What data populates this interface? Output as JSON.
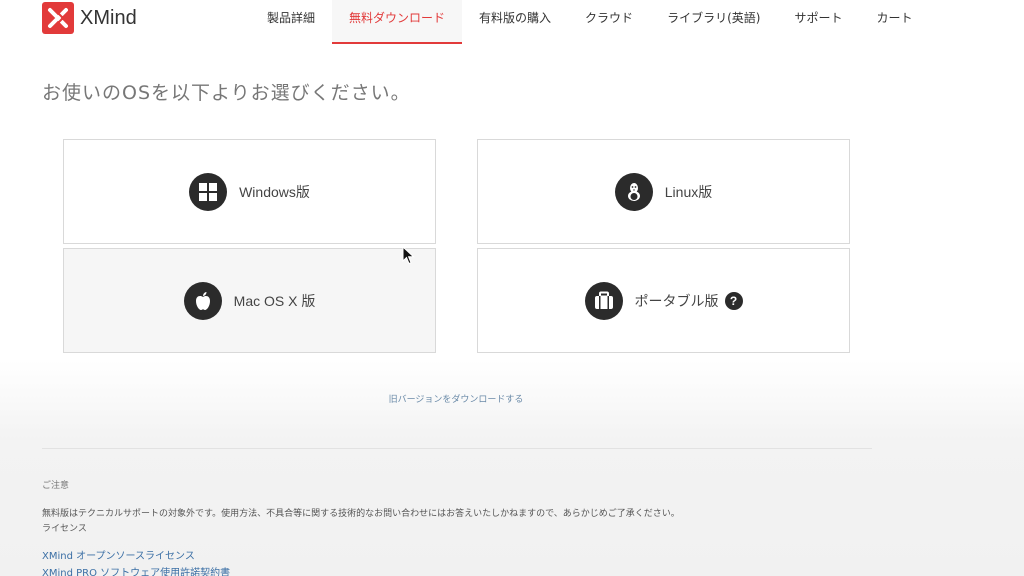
{
  "header": {
    "logo_text": "XMind",
    "nav": [
      {
        "label": "製品詳細"
      },
      {
        "label": "無料ダウンロード",
        "active": true
      },
      {
        "label": "有料版の購入"
      },
      {
        "label": "クラウド"
      },
      {
        "label": "ライブラリ(英語)"
      },
      {
        "label": "サポート"
      },
      {
        "label": "カート"
      }
    ]
  },
  "main": {
    "prompt": "お使いのOSを以下よりお選びください。",
    "options": [
      {
        "label": "Windows版",
        "icon": "windows-icon"
      },
      {
        "label": "Linux版",
        "icon": "linux-icon"
      },
      {
        "label": "Mac OS X 版",
        "icon": "apple-icon"
      },
      {
        "label": "ポータブル版",
        "icon": "briefcase-icon",
        "help": "?"
      }
    ],
    "old_version_link": "旧バージョンをダウンロードする"
  },
  "footer": {
    "note_title": "ご注意",
    "note_text": "無料版はテクニカルサポートの対象外です。使用方法、不具合等に関する技術的なお問い合わせにはお答えいたしかねますので、あらかじめご了承ください。",
    "license_title": "ライセンス",
    "links": [
      "XMind オープンソースライセンス",
      "XMind PRO ソフトウェア使用許諾契約書"
    ]
  },
  "colors": {
    "accent": "#e23a3a",
    "link": "#3b6fa5",
    "icon_bg": "#2b2b2b"
  }
}
